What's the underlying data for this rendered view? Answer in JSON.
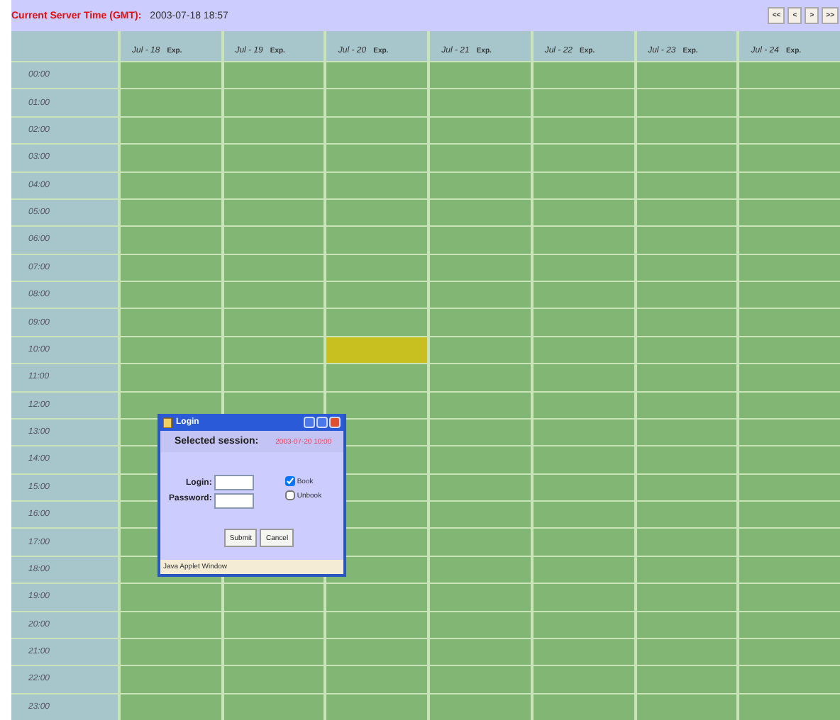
{
  "top_bar": {
    "label": "Current Server Time (GMT):",
    "value": "2003-07-18 18:57",
    "nav_buttons": [
      "<<",
      "<",
      ">",
      ">>"
    ]
  },
  "days": [
    {
      "label": "Jul - 18",
      "tag": "Exp."
    },
    {
      "label": "Jul - 19",
      "tag": "Exp."
    },
    {
      "label": "Jul - 20",
      "tag": "Exp."
    },
    {
      "label": "Jul - 21",
      "tag": "Exp."
    },
    {
      "label": "Jul - 22",
      "tag": "Exp."
    },
    {
      "label": "Jul - 23",
      "tag": "Exp."
    },
    {
      "label": "Jul - 24",
      "tag": "Exp."
    }
  ],
  "hours": [
    {
      "time": "00:00",
      "slots": [
        {
          "selected": false
        },
        {
          "selected": false
        },
        {
          "selected": false
        },
        {
          "selected": false
        },
        {
          "selected": false
        },
        {
          "selected": false
        },
        {
          "selected": false
        }
      ]
    },
    {
      "time": "01:00",
      "slots": [
        {
          "selected": false
        },
        {
          "selected": false
        },
        {
          "selected": false
        },
        {
          "selected": false
        },
        {
          "selected": false
        },
        {
          "selected": false
        },
        {
          "selected": false
        }
      ]
    },
    {
      "time": "02:00",
      "slots": [
        {
          "selected": false
        },
        {
          "selected": false
        },
        {
          "selected": false
        },
        {
          "selected": false
        },
        {
          "selected": false
        },
        {
          "selected": false
        },
        {
          "selected": false
        }
      ]
    },
    {
      "time": "03:00",
      "slots": [
        {
          "selected": false
        },
        {
          "selected": false
        },
        {
          "selected": false
        },
        {
          "selected": false
        },
        {
          "selected": false
        },
        {
          "selected": false
        },
        {
          "selected": false
        }
      ]
    },
    {
      "time": "04:00",
      "slots": [
        {
          "selected": false
        },
        {
          "selected": false
        },
        {
          "selected": false
        },
        {
          "selected": false
        },
        {
          "selected": false
        },
        {
          "selected": false
        },
        {
          "selected": false
        }
      ]
    },
    {
      "time": "05:00",
      "slots": [
        {
          "selected": false
        },
        {
          "selected": false
        },
        {
          "selected": false
        },
        {
          "selected": false
        },
        {
          "selected": false
        },
        {
          "selected": false
        },
        {
          "selected": false
        }
      ]
    },
    {
      "time": "06:00",
      "slots": [
        {
          "selected": false
        },
        {
          "selected": false
        },
        {
          "selected": false
        },
        {
          "selected": false
        },
        {
          "selected": false
        },
        {
          "selected": false
        },
        {
          "selected": false
        }
      ]
    },
    {
      "time": "07:00",
      "slots": [
        {
          "selected": false
        },
        {
          "selected": false
        },
        {
          "selected": false
        },
        {
          "selected": false
        },
        {
          "selected": false
        },
        {
          "selected": false
        },
        {
          "selected": false
        }
      ]
    },
    {
      "time": "08:00",
      "slots": [
        {
          "selected": false
        },
        {
          "selected": false
        },
        {
          "selected": false
        },
        {
          "selected": false
        },
        {
          "selected": false
        },
        {
          "selected": false
        },
        {
          "selected": false
        }
      ]
    },
    {
      "time": "09:00",
      "slots": [
        {
          "selected": false
        },
        {
          "selected": false
        },
        {
          "selected": false
        },
        {
          "selected": false
        },
        {
          "selected": false
        },
        {
          "selected": false
        },
        {
          "selected": false
        }
      ]
    },
    {
      "time": "10:00",
      "slots": [
        {
          "selected": false
        },
        {
          "selected": false
        },
        {
          "selected": true
        },
        {
          "selected": false
        },
        {
          "selected": false
        },
        {
          "selected": false
        },
        {
          "selected": false
        }
      ]
    },
    {
      "time": "11:00",
      "slots": [
        {
          "selected": false
        },
        {
          "selected": false
        },
        {
          "selected": false
        },
        {
          "selected": false
        },
        {
          "selected": false
        },
        {
          "selected": false
        },
        {
          "selected": false
        }
      ]
    },
    {
      "time": "12:00",
      "slots": [
        {
          "selected": false
        },
        {
          "selected": false
        },
        {
          "selected": false
        },
        {
          "selected": false
        },
        {
          "selected": false
        },
        {
          "selected": false
        },
        {
          "selected": false
        }
      ]
    },
    {
      "time": "13:00",
      "slots": [
        {
          "selected": false
        },
        {
          "selected": false
        },
        {
          "selected": false
        },
        {
          "selected": false
        },
        {
          "selected": false
        },
        {
          "selected": false
        }
      ]
    },
    {
      "time": "14:00",
      "slots": [
        {
          "selected": false
        },
        {
          "selected": false
        },
        {
          "selected": false
        },
        {
          "selected": false
        },
        {
          "selected": false
        },
        {
          "selected": false
        }
      ]
    },
    {
      "time": "15:00",
      "slots": [
        {
          "selected": false
        },
        {
          "selected": false
        },
        {
          "selected": false
        },
        {
          "selected": false
        },
        {
          "selected": false
        },
        {
          "selected": false
        }
      ]
    },
    {
      "time": "16:00",
      "slots": [
        {
          "selected": false
        },
        {
          "selected": false
        },
        {
          "selected": false
        },
        {
          "selected": false
        },
        {
          "selected": false
        },
        {
          "selected": false
        }
      ]
    },
    {
      "time": "17:00",
      "slots": [
        {
          "selected": false
        },
        {
          "selected": false
        },
        {
          "selected": false
        },
        {
          "selected": false
        },
        {
          "selected": false
        },
        {
          "selected": false
        }
      ]
    },
    {
      "time": "18:00",
      "slots": [
        {
          "selected": false
        },
        {
          "selected": false
        },
        {
          "selected": false
        },
        {
          "selected": false
        },
        {
          "selected": false
        },
        {
          "selected": false
        },
        {
          "selected": false
        }
      ]
    },
    {
      "time": "19:00",
      "slots": [
        {
          "selected": false
        },
        {
          "selected": false
        },
        {
          "selected": false
        },
        {
          "selected": false
        },
        {
          "selected": false
        },
        {
          "selected": false
        },
        {
          "selected": false
        }
      ]
    },
    {
      "time": "20:00",
      "slots": [
        {
          "selected": false
        },
        {
          "selected": false
        },
        {
          "selected": false
        },
        {
          "selected": false
        },
        {
          "selected": false
        },
        {
          "selected": false
        },
        {
          "selected": false
        }
      ]
    },
    {
      "time": "21:00",
      "slots": [
        {
          "selected": false
        },
        {
          "selected": false
        },
        {
          "selected": false
        },
        {
          "selected": false
        },
        {
          "selected": false
        },
        {
          "selected": false
        },
        {
          "selected": false
        }
      ]
    },
    {
      "time": "22:00",
      "slots": [
        {
          "selected": false
        },
        {
          "selected": false
        },
        {
          "selected": false
        },
        {
          "selected": false
        },
        {
          "selected": false
        },
        {
          "selected": false
        },
        {
          "selected": false
        }
      ]
    },
    {
      "time": "23:00",
      "slots": [
        {
          "selected": false
        },
        {
          "selected": false
        },
        {
          "selected": false
        },
        {
          "selected": false
        },
        {
          "selected": false
        },
        {
          "selected": false
        },
        {
          "selected": false
        }
      ]
    }
  ],
  "dialog": {
    "title": "Login",
    "session_label": "Selected session:",
    "session_value": "2003-07-20 10:00",
    "login_label": "Login:",
    "password_label": "Password:",
    "options": [
      {
        "label": "Book",
        "checked": true
      },
      {
        "label": "Unbook",
        "checked": false
      }
    ],
    "buttons": [
      "Submit",
      "Cancel"
    ],
    "status": "Java Applet Window"
  }
}
